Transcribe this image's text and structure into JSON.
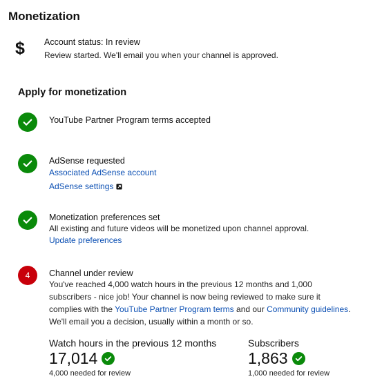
{
  "header": {
    "title": "Monetization"
  },
  "account": {
    "icon": "dollar-icon",
    "status": "Account status: In review",
    "description": "Review started. We'll email you when your channel is approved."
  },
  "apply": {
    "title": "Apply for monetization",
    "steps": [
      {
        "state": "done",
        "icon": "check-icon",
        "title": "YouTube Partner Program terms accepted"
      },
      {
        "state": "done",
        "icon": "check-icon",
        "title": "AdSense requested",
        "links": [
          "Associated AdSense account",
          "AdSense settings"
        ]
      },
      {
        "state": "done",
        "icon": "check-icon",
        "title": "Monetization preferences set",
        "text": "All existing and future videos will be monetized upon channel approval.",
        "link": "Update preferences"
      },
      {
        "state": "current",
        "number": "4",
        "title": "Channel under review",
        "text_line1": "You've reached 4,000 watch hours in the previous 12 months and 1,000",
        "text_line2": "subscribers - nice job! Your channel is now being reviewed to make sure it",
        "text_line3_pre": "complies with the ",
        "text_line3_link1": "YouTube Partner Program terms",
        "text_line3_mid": " and our ",
        "text_line3_link2": "Community guidelines",
        "text_line3_post": ".",
        "text_line4": "We'll email you a decision, usually within a month or so."
      }
    ]
  },
  "stats": {
    "watch_hours": {
      "label": "Watch hours in the previous 12 months",
      "value": "17,014",
      "note": "4,000 needed for review"
    },
    "subscribers": {
      "label": "Subscribers",
      "value": "1,863",
      "note": "1,000 needed for review"
    }
  },
  "colors": {
    "success": "#0a8a0a",
    "alert": "#c8000a",
    "link": "#0b4fb3"
  }
}
